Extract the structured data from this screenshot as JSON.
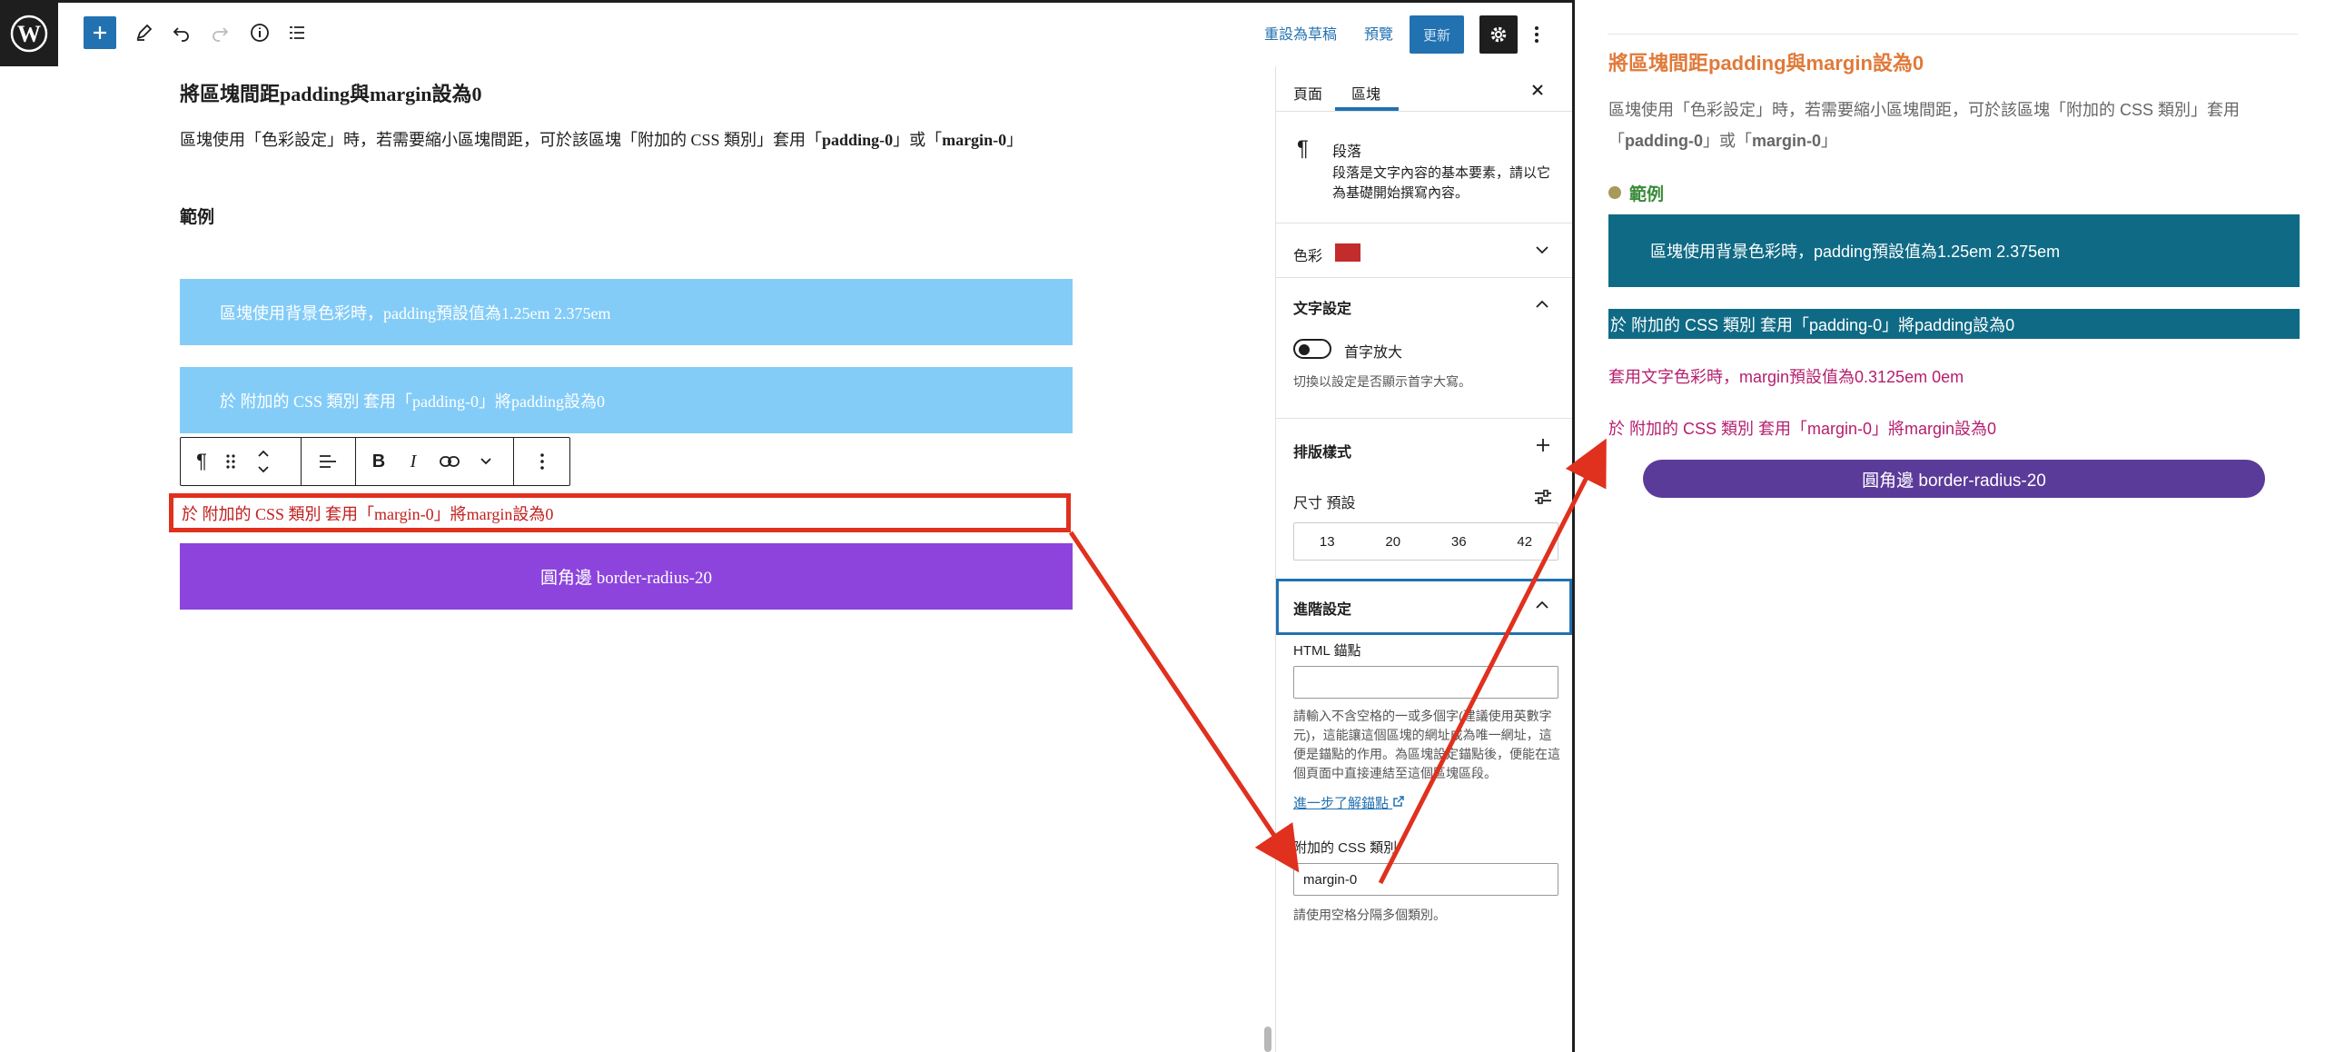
{
  "toolbar": {
    "save_draft": "重設為草稿",
    "preview": "預覽",
    "update": "更新"
  },
  "canvas": {
    "heading": "將區塊間距padding與margin設為0",
    "para_pre": "區塊使用「色彩設定」時，若需要縮小區塊間距，可於該區塊「附加的 CSS 類別」套用「",
    "para_b1": "padding-0",
    "para_mid": "」或「",
    "para_b2": "margin-0",
    "para_post": "」",
    "example": "範例",
    "block1": "區塊使用背景色彩時，padding預設值為1.25em 2.375em",
    "block2": "於 附加的 CSS 類別 套用「padding-0」將padding設為0",
    "selected": "於 附加的 CSS 類別 套用「margin-0」將margin設為0",
    "button": "圓角邊 border-radius-20"
  },
  "sidebar": {
    "tab_page": "頁面",
    "tab_block": "區塊",
    "block_name": "段落",
    "block_desc": "段落是文字內容的基本要素，請以它為基礎開始撰寫內容。",
    "color_label": "色彩",
    "color_swatch": "#c22c2c",
    "typography_title": "文字設定",
    "dropcap_label": "首字放大",
    "dropcap_help": "切換以設定是否顯示首字大寫。",
    "layout_title": "排版樣式",
    "size_label": "尺寸 預設",
    "sizes": [
      "13",
      "20",
      "36",
      "42"
    ],
    "advanced_title": "進階設定",
    "anchor_label": "HTML 錨點",
    "anchor_value": "",
    "anchor_help": "請輸入不含空格的一或多個字(建議使用英數字元)，這能讓這個區塊的網址成為唯一網址，這便是錨點的作用。為區塊設定錨點後，便能在這個頁面中直接連結至這個區塊區段。",
    "anchor_link": "進一步了解錨點",
    "css_label": "附加的 CSS 類別",
    "css_value": "margin-0",
    "css_help": "請使用空格分隔多個類別。"
  },
  "preview": {
    "heading": "將區塊間距padding與margin設為0",
    "para_pre": "區塊使用「色彩設定」時，若需要縮小區塊間距，可於該區塊「附加的 CSS 類別」套用「",
    "para_b1": "padding-0",
    "para_mid": "」或「",
    "para_b2": "margin-0",
    "para_post": "」",
    "example": "範例",
    "block1": "區塊使用背景色彩時，padding預設值為1.25em 2.375em",
    "block2": "於 附加的 CSS 類別 套用「padding-0」將padding設為0",
    "text1": "套用文字色彩時，margin預設值為0.3125em 0em",
    "text2": "於 附加的 CSS 類別 套用「margin-0」將margin設為0",
    "button": "圓角邊 border-radius-20"
  }
}
